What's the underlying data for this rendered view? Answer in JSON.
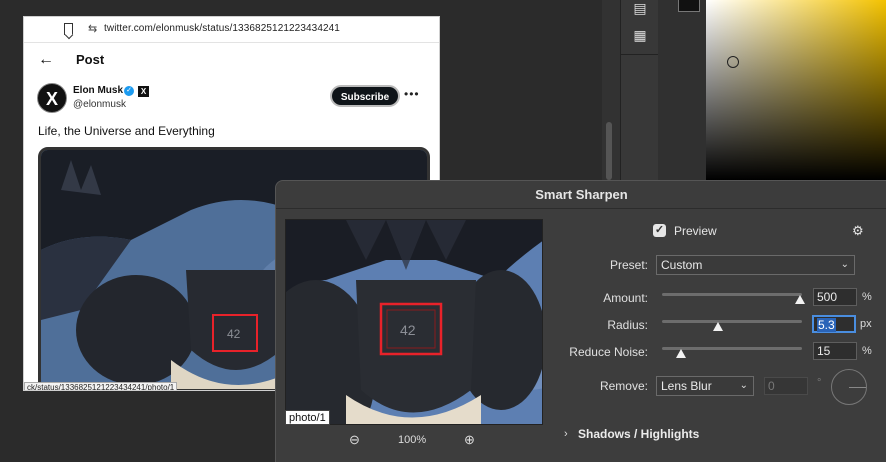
{
  "browser": {
    "url": "twitter.com/elonmusk/status/1336825121223434241",
    "header_title": "Post",
    "avatar_glyph": "X",
    "author_name": "Elon Musk",
    "author_handle": "@elonmusk",
    "subscribe_label": "Subscribe",
    "more_label": "•••",
    "post_text": "Life, the Universe and Everything",
    "image_number": "42",
    "status_url": "ck/status/1336825121223434241/photo/1"
  },
  "dialog": {
    "title": "Smart Sharpen",
    "preview_label": "Preview",
    "preview_checked": true,
    "preview_number": "42",
    "photo_label": "photo/1",
    "zoom": "100%",
    "preset_label": "Preset:",
    "preset_value": "Custom",
    "amount_label": "Amount:",
    "amount_value": "500",
    "amount_unit": "%",
    "amount_level": 0.98,
    "radius_label": "Radius:",
    "radius_value": "5.3",
    "radius_unit": "px",
    "radius_level": 0.4,
    "noise_label": "Reduce Noise:",
    "noise_value": "15",
    "noise_unit": "%",
    "noise_level": 0.14,
    "remove_label": "Remove:",
    "remove_value": "Lens Blur",
    "angle_value": "0",
    "angle_unit": "°",
    "shadows_label": "Shadows / Highlights"
  },
  "icons": {
    "bookmark": "bookmark-icon",
    "tune": "tune-icon",
    "back": "back-arrow-icon",
    "verified": "verified-badge-icon",
    "gear": "gear-icon",
    "zoom_out": "zoom-out-icon",
    "zoom_in": "zoom-in-icon"
  },
  "colors": {
    "highlight_box": "#e8222a",
    "sky": "#5d7fb2",
    "verified": "#1d9bf0",
    "selection": "#2a64b8"
  }
}
